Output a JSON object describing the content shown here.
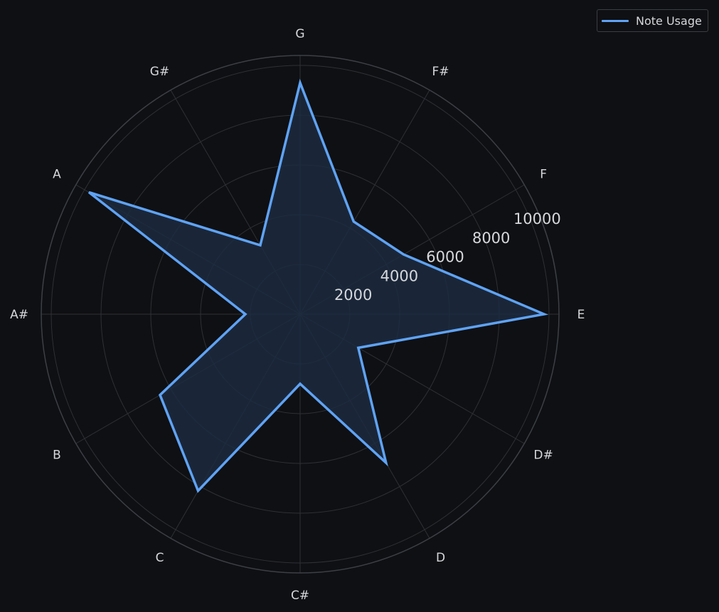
{
  "chart_data": {
    "type": "radar",
    "categories": [
      "E",
      "F",
      "F#",
      "G",
      "G#",
      "A",
      "A#",
      "B",
      "C",
      "C#",
      "D",
      "D#"
    ],
    "series": [
      {
        "name": "Note Usage",
        "values": [
          9800,
          4800,
          4300,
          9300,
          3200,
          9800,
          2200,
          6500,
          8200,
          2800,
          6900,
          2700
        ]
      }
    ],
    "radial_ticks": [
      2000,
      4000,
      6000,
      8000,
      10000
    ],
    "rlim": [
      0,
      10200
    ],
    "grid": true,
    "legend_position": "top-right",
    "colors": {
      "background": "#0f1013",
      "series_line": "#5fa3f5",
      "series_fill": "#1c2a3f",
      "grid": "#2e3036",
      "outer_ring": "#3c3f46",
      "text": "#d6d8dc"
    }
  }
}
